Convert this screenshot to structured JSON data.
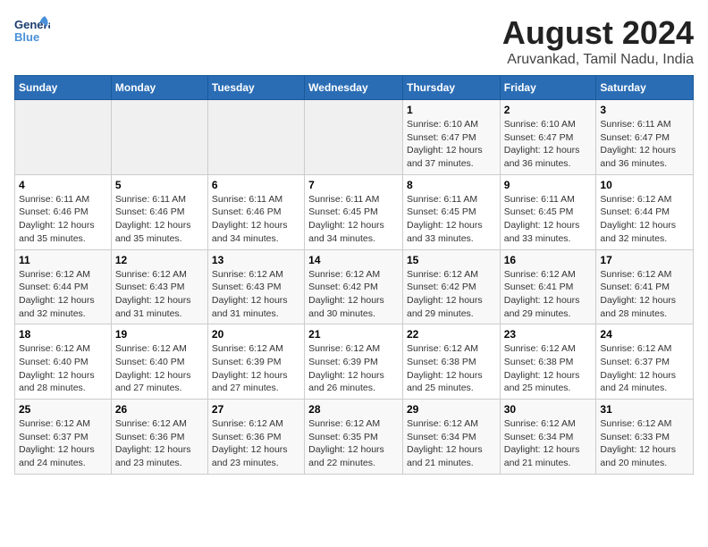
{
  "header": {
    "title": "August 2024",
    "subtitle": "Aruvankad, Tamil Nadu, India",
    "logo_text_general": "General",
    "logo_text_blue": "Blue"
  },
  "calendar": {
    "days_of_week": [
      "Sunday",
      "Monday",
      "Tuesday",
      "Wednesday",
      "Thursday",
      "Friday",
      "Saturday"
    ],
    "weeks": [
      [
        {
          "day": "",
          "info": ""
        },
        {
          "day": "",
          "info": ""
        },
        {
          "day": "",
          "info": ""
        },
        {
          "day": "",
          "info": ""
        },
        {
          "day": "1",
          "info": "Sunrise: 6:10 AM\nSunset: 6:47 PM\nDaylight: 12 hours\nand 37 minutes."
        },
        {
          "day": "2",
          "info": "Sunrise: 6:10 AM\nSunset: 6:47 PM\nDaylight: 12 hours\nand 36 minutes."
        },
        {
          "day": "3",
          "info": "Sunrise: 6:11 AM\nSunset: 6:47 PM\nDaylight: 12 hours\nand 36 minutes."
        }
      ],
      [
        {
          "day": "4",
          "info": "Sunrise: 6:11 AM\nSunset: 6:46 PM\nDaylight: 12 hours\nand 35 minutes."
        },
        {
          "day": "5",
          "info": "Sunrise: 6:11 AM\nSunset: 6:46 PM\nDaylight: 12 hours\nand 35 minutes."
        },
        {
          "day": "6",
          "info": "Sunrise: 6:11 AM\nSunset: 6:46 PM\nDaylight: 12 hours\nand 34 minutes."
        },
        {
          "day": "7",
          "info": "Sunrise: 6:11 AM\nSunset: 6:45 PM\nDaylight: 12 hours\nand 34 minutes."
        },
        {
          "day": "8",
          "info": "Sunrise: 6:11 AM\nSunset: 6:45 PM\nDaylight: 12 hours\nand 33 minutes."
        },
        {
          "day": "9",
          "info": "Sunrise: 6:11 AM\nSunset: 6:45 PM\nDaylight: 12 hours\nand 33 minutes."
        },
        {
          "day": "10",
          "info": "Sunrise: 6:12 AM\nSunset: 6:44 PM\nDaylight: 12 hours\nand 32 minutes."
        }
      ],
      [
        {
          "day": "11",
          "info": "Sunrise: 6:12 AM\nSunset: 6:44 PM\nDaylight: 12 hours\nand 32 minutes."
        },
        {
          "day": "12",
          "info": "Sunrise: 6:12 AM\nSunset: 6:43 PM\nDaylight: 12 hours\nand 31 minutes."
        },
        {
          "day": "13",
          "info": "Sunrise: 6:12 AM\nSunset: 6:43 PM\nDaylight: 12 hours\nand 31 minutes."
        },
        {
          "day": "14",
          "info": "Sunrise: 6:12 AM\nSunset: 6:42 PM\nDaylight: 12 hours\nand 30 minutes."
        },
        {
          "day": "15",
          "info": "Sunrise: 6:12 AM\nSunset: 6:42 PM\nDaylight: 12 hours\nand 29 minutes."
        },
        {
          "day": "16",
          "info": "Sunrise: 6:12 AM\nSunset: 6:41 PM\nDaylight: 12 hours\nand 29 minutes."
        },
        {
          "day": "17",
          "info": "Sunrise: 6:12 AM\nSunset: 6:41 PM\nDaylight: 12 hours\nand 28 minutes."
        }
      ],
      [
        {
          "day": "18",
          "info": "Sunrise: 6:12 AM\nSunset: 6:40 PM\nDaylight: 12 hours\nand 28 minutes."
        },
        {
          "day": "19",
          "info": "Sunrise: 6:12 AM\nSunset: 6:40 PM\nDaylight: 12 hours\nand 27 minutes."
        },
        {
          "day": "20",
          "info": "Sunrise: 6:12 AM\nSunset: 6:39 PM\nDaylight: 12 hours\nand 27 minutes."
        },
        {
          "day": "21",
          "info": "Sunrise: 6:12 AM\nSunset: 6:39 PM\nDaylight: 12 hours\nand 26 minutes."
        },
        {
          "day": "22",
          "info": "Sunrise: 6:12 AM\nSunset: 6:38 PM\nDaylight: 12 hours\nand 25 minutes."
        },
        {
          "day": "23",
          "info": "Sunrise: 6:12 AM\nSunset: 6:38 PM\nDaylight: 12 hours\nand 25 minutes."
        },
        {
          "day": "24",
          "info": "Sunrise: 6:12 AM\nSunset: 6:37 PM\nDaylight: 12 hours\nand 24 minutes."
        }
      ],
      [
        {
          "day": "25",
          "info": "Sunrise: 6:12 AM\nSunset: 6:37 PM\nDaylight: 12 hours\nand 24 minutes."
        },
        {
          "day": "26",
          "info": "Sunrise: 6:12 AM\nSunset: 6:36 PM\nDaylight: 12 hours\nand 23 minutes."
        },
        {
          "day": "27",
          "info": "Sunrise: 6:12 AM\nSunset: 6:36 PM\nDaylight: 12 hours\nand 23 minutes."
        },
        {
          "day": "28",
          "info": "Sunrise: 6:12 AM\nSunset: 6:35 PM\nDaylight: 12 hours\nand 22 minutes."
        },
        {
          "day": "29",
          "info": "Sunrise: 6:12 AM\nSunset: 6:34 PM\nDaylight: 12 hours\nand 21 minutes."
        },
        {
          "day": "30",
          "info": "Sunrise: 6:12 AM\nSunset: 6:34 PM\nDaylight: 12 hours\nand 21 minutes."
        },
        {
          "day": "31",
          "info": "Sunrise: 6:12 AM\nSunset: 6:33 PM\nDaylight: 12 hours\nand 20 minutes."
        }
      ]
    ]
  }
}
